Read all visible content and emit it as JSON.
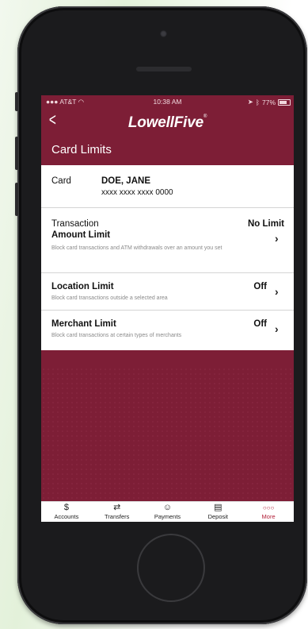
{
  "status_bar": {
    "carrier": "AT&T",
    "time": "10:38 AM",
    "battery": "77%"
  },
  "header": {
    "back_icon": "chevron-left-icon",
    "logo": "LowellFive",
    "title": "Card Limits"
  },
  "card": {
    "label": "Card",
    "holder": "DOE, JANE",
    "number": "xxxx xxxx xxxx 0000"
  },
  "limits": [
    {
      "title_line1": "Transaction",
      "title_line2": "Amount Limit",
      "value": "No Limit",
      "description": "Block card transactions and ATM withdrawals over an amount you set"
    },
    {
      "title": "Location Limit",
      "value": "Off",
      "description": "Block card transactions outside a selected area"
    },
    {
      "title": "Merchant Limit",
      "value": "Off",
      "description": "Block card transactions at certain types of merchants"
    }
  ],
  "tabs": [
    {
      "label": "Accounts",
      "icon": "dollar-icon"
    },
    {
      "label": "Transfers",
      "icon": "transfer-icon"
    },
    {
      "label": "Payments",
      "icon": "payments-icon"
    },
    {
      "label": "Deposit",
      "icon": "deposit-check-icon"
    },
    {
      "label": "More",
      "icon": "more-dots-icon",
      "active": true
    }
  ],
  "colors": {
    "brand": "#7d1e36",
    "accent": "#b21f38"
  }
}
